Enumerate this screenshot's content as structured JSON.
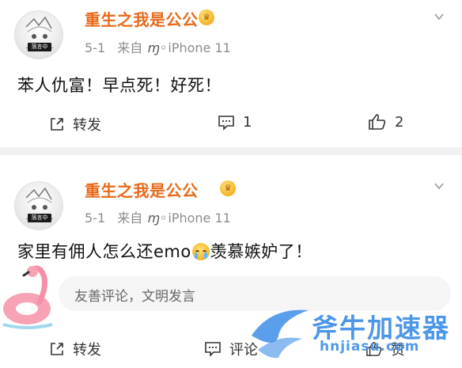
{
  "posts": [
    {
      "username": "重生之我是公公",
      "avatar_badge": "落言中",
      "date": "5-1",
      "source_prefix": "来自",
      "device_glyph": "ɱ◦",
      "device": "iPhone 11",
      "content": "苯人仇富！早点死！好死！",
      "actions": {
        "repost_label": "转发",
        "comment_count": "1",
        "like_count": "2"
      }
    },
    {
      "username": "重生之我是公公",
      "avatar_badge": "落言中",
      "date": "5-1",
      "source_prefix": "来自",
      "device_glyph": "ɱ◦",
      "device": "iPhone 11",
      "content_before": "家里有佣人怎么还emo",
      "content_after": "羡慕嫉妒了！",
      "comment_placeholder": "友善评论，文明发言",
      "actions": {
        "repost_label": "转发",
        "comment_label": "评论",
        "like_label": "赞"
      }
    }
  ],
  "watermark": {
    "title": "斧牛加速器",
    "url": "hnjiasu.com"
  },
  "colors": {
    "username": "#e8691a",
    "vip": "#f3b324",
    "watermark": "#3d8ee8",
    "separator": "#f2f2f2"
  },
  "icons": [
    "vip-crown-icon",
    "chevron-down-icon",
    "repost-icon",
    "comment-icon",
    "like-icon",
    "crying-emoji-icon",
    "flamingo-float-icon",
    "watermark-logo-icon"
  ]
}
